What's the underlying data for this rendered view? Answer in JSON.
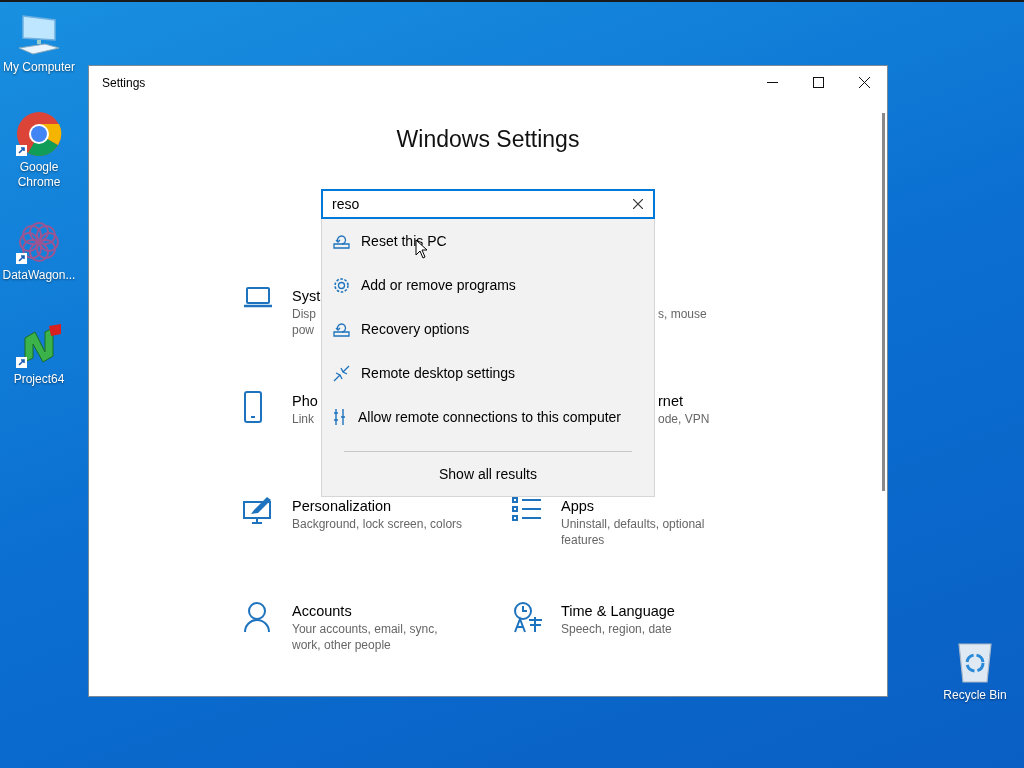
{
  "desktop_icons": [
    {
      "label": "My Computer"
    },
    {
      "label": "Google Chrome"
    },
    {
      "label": "DataWagon..."
    },
    {
      "label": "Project64"
    },
    {
      "label": "Recycle Bin"
    }
  ],
  "window": {
    "title": "Settings",
    "heading": "Windows Settings"
  },
  "search": {
    "value": "reso"
  },
  "results": [
    {
      "label": "Reset this PC"
    },
    {
      "label": "Add or remove programs"
    },
    {
      "label": "Recovery options"
    },
    {
      "label": "Remote desktop settings"
    },
    {
      "label": "Allow remote connections to this computer"
    }
  ],
  "show_all": "Show all results",
  "categories": [
    {
      "title": "Syst",
      "description": [
        "Disp",
        "pow"
      ]
    },
    {
      "description": [
        "s, mouse"
      ]
    },
    {
      "title": "Pho",
      "description": [
        "Link"
      ]
    },
    {
      "title": "rnet",
      "description": [
        "ode, VPN"
      ]
    },
    {
      "title": "Personalization",
      "description": [
        "Background, lock screen, colors"
      ]
    },
    {
      "title": "Apps",
      "description": [
        "Uninstall, defaults, optional features"
      ]
    },
    {
      "title": "Accounts",
      "description": [
        "Your accounts, email, sync, work, other people"
      ]
    },
    {
      "title": "Time & Language",
      "description": [
        "Speech, region, date"
      ]
    }
  ]
}
